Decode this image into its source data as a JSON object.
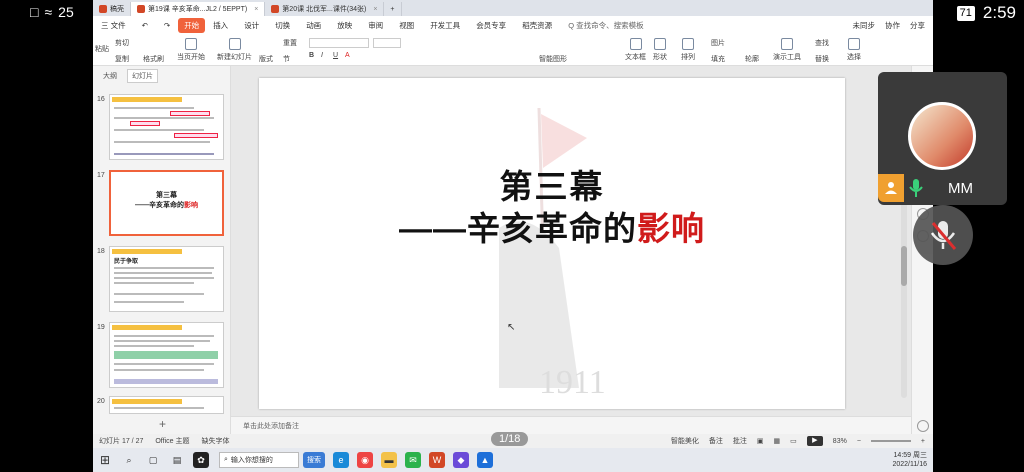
{
  "android": {
    "left_text": "25",
    "time": "2:59",
    "battery": "71"
  },
  "tabs": [
    {
      "label": "稿壳"
    },
    {
      "label": "第19课  辛亥革命...JL2 / 5EPPT)"
    },
    {
      "label": "第20课  北伐军...课件(34张)"
    }
  ],
  "menu": {
    "file": "三 文件",
    "items": [
      "开始",
      "插入",
      "设计",
      "切换",
      "动画",
      "放映",
      "审阅",
      "视图",
      "开发工具",
      "会员专享",
      "稻壳资源"
    ],
    "search": "Q 查找命令、搜索模板",
    "sync": "未同步",
    "collab": "协作",
    "share": "分享"
  },
  "ribbon": {
    "cut": "剪切",
    "copy": "复制",
    "paste": "粘贴",
    "format_painter": "格式刷",
    "play_from": "当页开始",
    "new_slide": "新建幻灯片",
    "layout": "版式",
    "section": "节",
    "reset": "重置",
    "textbox": "文本框",
    "shape": "形状",
    "arrange": "排列",
    "picture": "图片",
    "fill": "填充",
    "outline": "轮廓",
    "presenter": "演示工具",
    "find": "查找",
    "replace": "替换",
    "select": "选择",
    "smartart": "智能图形"
  },
  "left_panel": {
    "tab_outline": "大纲",
    "tab_slides": "幻灯片",
    "slides": [
      {
        "num": "16"
      },
      {
        "num": "17",
        "title": "第三幕",
        "sub_prefix": "——辛亥革命的",
        "sub_hl": "影响"
      },
      {
        "num": "18",
        "heading": "民于争取"
      },
      {
        "num": "19"
      },
      {
        "num": "20"
      }
    ],
    "add": "+"
  },
  "slide": {
    "title": "第三幕",
    "subtitle_prefix": "——辛亥革命的",
    "subtitle_highlight": "影响",
    "year": "1911"
  },
  "notes_placeholder": "单击此处添加备注",
  "status": {
    "slide_count": "幻灯片 17 / 27",
    "theme": "Office 主题",
    "missing_font": "缺失字体",
    "page_badge": "1/18",
    "smart_beautify": "智能美化",
    "notes": "备注",
    "comments": "批注",
    "zoom": "83%"
  },
  "taskbar": {
    "search_placeholder": "输入你想搜的",
    "search_btn": "搜索",
    "clock_time": "14:59 周三",
    "clock_date": "2022/11/16"
  },
  "call": {
    "name": "MM"
  },
  "colors": {
    "accent": "#f0623b",
    "highlight_red": "#d01b1b",
    "call_orange": "#f0a030",
    "mic_green": "#3ad07a"
  }
}
